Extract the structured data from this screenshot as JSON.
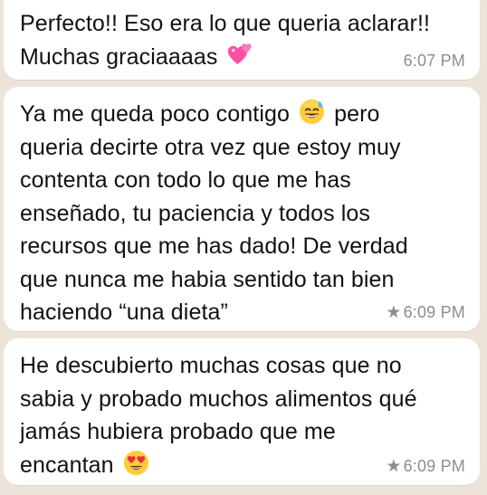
{
  "messages": [
    {
      "lines": [
        "Perfecto!! Eso era lo que queria aclarar!!",
        "Muchas graciaaaas "
      ],
      "emoji": "two-hearts-emoji",
      "time": "6:07 PM",
      "starred": false
    },
    {
      "line1_before_emoji": "Ya me queda poco contigo ",
      "line1_after_emoji": " pero",
      "emoji": "sweat-smile-emoji",
      "rest": "queria decirte otra vez que estoy muy\ncontenta con todo lo que me has\nenseñado, tu paciencia y todos los\nrecursos que me has dado! De verdad\nque nunca me habia sentido tan bien\nhaciendo “una dieta”",
      "time": "6:09 PM",
      "starred": true
    },
    {
      "body_before_emoji": "He descubierto muchas cosas que no\nsabia y probado muchos alimentos qué\njamás hubiera probado que me\nencantan ",
      "emoji": "heart-eyes-emoji",
      "time": "6:09 PM",
      "starred": true
    }
  ],
  "star_glyph": "★",
  "colors": {
    "background": "#ece4d9",
    "bubble": "#ffffff",
    "text": "#111111",
    "meta": "#8d8d8d"
  }
}
